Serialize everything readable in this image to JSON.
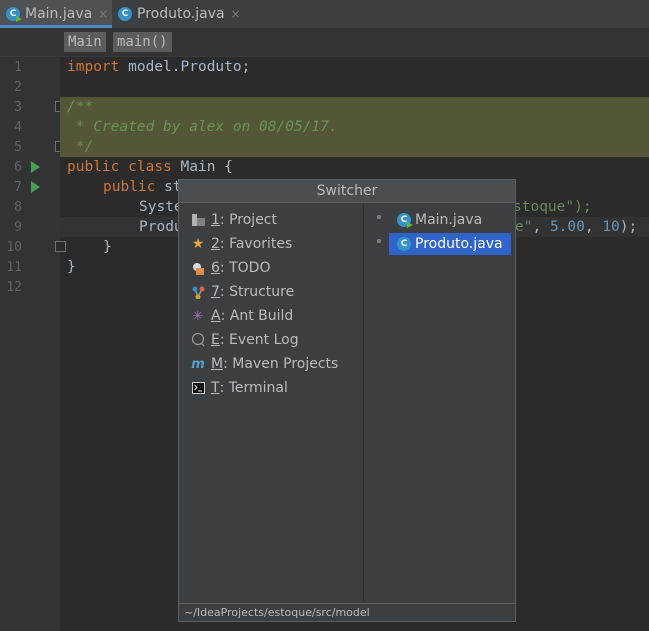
{
  "tabs": [
    {
      "label": "Main.java",
      "close": "×",
      "icon": "class-main-icon",
      "active": true
    },
    {
      "label": "Produto.java",
      "close": "×",
      "icon": "class-icon",
      "active": false
    }
  ],
  "breadcrumbs": [
    "Main",
    "main()"
  ],
  "line_numbers": [
    "1",
    "2",
    "3",
    "4",
    "5",
    "6",
    "7",
    "8",
    "9",
    "10",
    "11",
    "12"
  ],
  "code": {
    "l1_kw": "import",
    "l1_rest": " model.Produto;",
    "l3": "/**",
    "l4": " * Created by alex on 08/05/17.",
    "l5": " */",
    "l6_kw1": "public",
    "l6_kw2": "class",
    "l6_rest": " Main {",
    "l7_kw": "public",
    "l7_rest": " st",
    "l8_left": "Syste",
    "l8_str": "stoque",
    "l8_end": "\");",
    "l9_left": "Produ",
    "l9_str": "e\"",
    "l9_comma": ", ",
    "l9_num1": "5.00",
    "l9_num2": "10",
    "l9_end": ");",
    "l10": "}",
    "l11": "}"
  },
  "switcher": {
    "title": "Switcher",
    "tool_windows": [
      {
        "key": "1",
        "label": ": Project",
        "icon": "project-icon"
      },
      {
        "key": "2",
        "label": ": Favorites",
        "icon": "star-icon"
      },
      {
        "key": "6",
        "label": ": TODO",
        "icon": "todo-icon"
      },
      {
        "key": "7",
        "label": ": Structure",
        "icon": "structure-icon"
      },
      {
        "key": "A",
        "label": ": Ant Build",
        "icon": "ant-icon"
      },
      {
        "key": "E",
        "label": ": Event Log",
        "icon": "event-log-icon"
      },
      {
        "key": "M",
        "label": ": Maven Projects",
        "icon": "maven-icon"
      },
      {
        "key": "T",
        "label": ": Terminal",
        "icon": "terminal-icon"
      }
    ],
    "files": [
      {
        "label": "Main.java",
        "icon": "class-main-icon",
        "selected": false
      },
      {
        "label": "Produto.java",
        "icon": "class-icon",
        "selected": true
      }
    ],
    "footer": "~/IdeaProjects/estoque/src/model"
  },
  "colors": {
    "background": "#2b2b2b",
    "keyword": "#cc7832",
    "comment": "#629755",
    "string": "#6a8759",
    "number": "#6897bb",
    "selection": "#2f65ca"
  }
}
